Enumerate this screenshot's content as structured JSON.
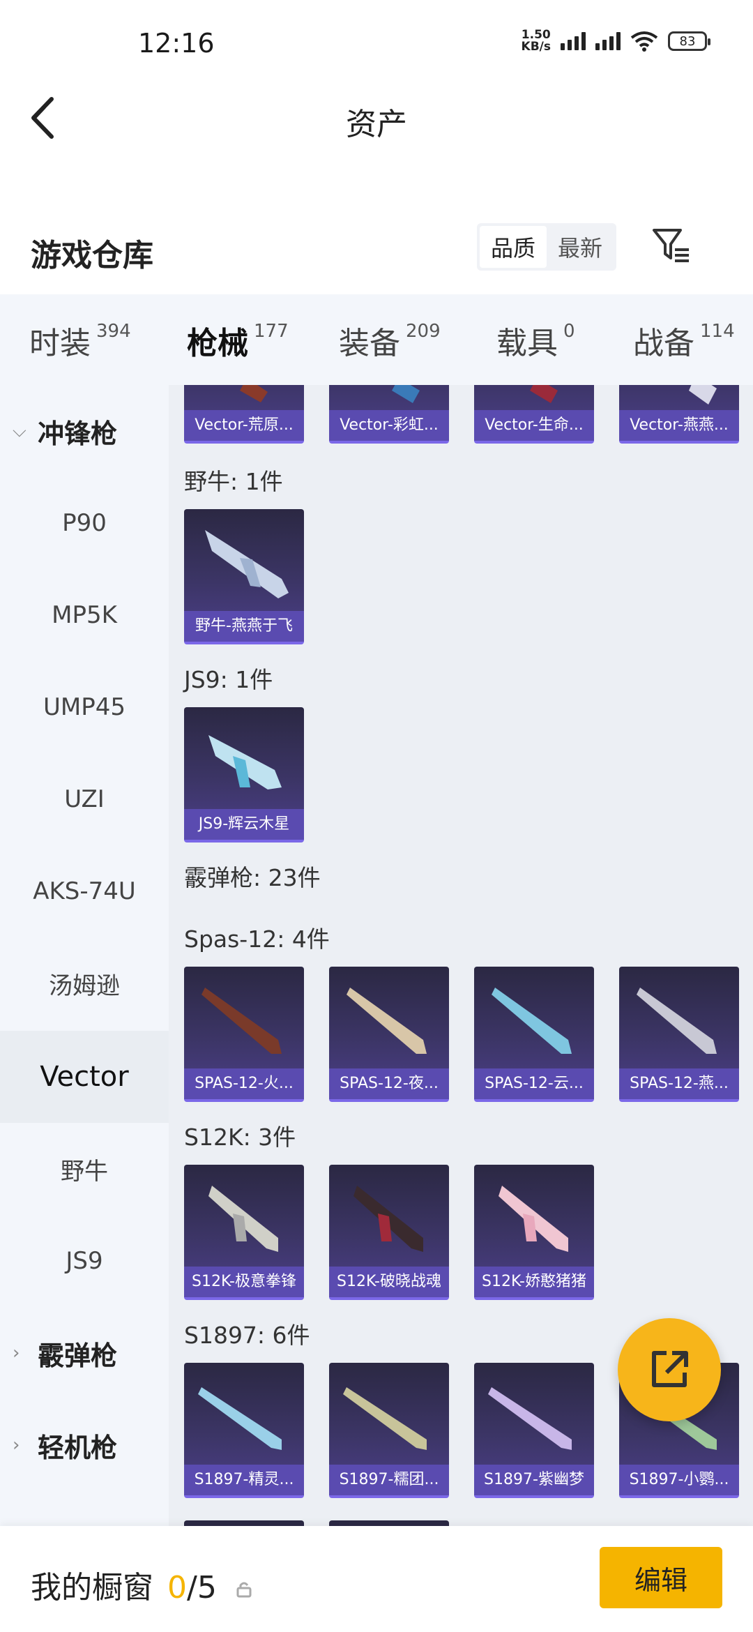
{
  "status_bar": {
    "time": "12:16",
    "net_speed_value": "1.50",
    "net_speed_unit": "KB/s",
    "battery": "83"
  },
  "header": {
    "title": "资产"
  },
  "warehouse": {
    "title": "游戏仓库",
    "sort_options": [
      "品质",
      "最新"
    ],
    "sort_active": "品质"
  },
  "tabs": [
    {
      "name": "时装",
      "count": "394"
    },
    {
      "name": "枪械",
      "count": "177"
    },
    {
      "name": "装备",
      "count": "209"
    },
    {
      "name": "载具",
      "count": "0"
    },
    {
      "name": "战备",
      "count": "114"
    }
  ],
  "sidebar": {
    "group_smg": "冲锋枪",
    "items": [
      "P90",
      "MP5K",
      "UMP45",
      "UZI",
      "AKS-74U",
      "汤姆逊",
      "Vector",
      "野牛",
      "JS9"
    ],
    "group_shotgun": "霰弹枪",
    "group_lmg": "轻机枪"
  },
  "content": {
    "vector_cards": [
      "Vector-荒原...",
      "Vector-彩虹...",
      "Vector-生命...",
      "Vector-燕燕..."
    ],
    "bison_label": "野牛: 1件",
    "bison_cards": [
      "野牛-燕燕于飞"
    ],
    "js9_label": "JS9: 1件",
    "js9_cards": [
      "JS9-辉云木星"
    ],
    "shotgun_label": "霰弹枪: 23件",
    "spas_label": "Spas-12: 4件",
    "spas_cards": [
      "SPAS-12-火...",
      "SPAS-12-夜...",
      "SPAS-12-云...",
      "SPAS-12-燕..."
    ],
    "s12k_label": "S12K: 3件",
    "s12k_cards": [
      "S12K-极意拳锋",
      "S12K-破晓战魂",
      "S12K-娇憨猪猪"
    ],
    "s1897_label": "S1897: 6件",
    "s1897_cards": [
      "S1897-精灵...",
      "S1897-糯团...",
      "S1897-紫幽梦",
      "S1897-小鹦..."
    ]
  },
  "bottom_bar": {
    "showcase_label": "我的橱窗",
    "current": "0",
    "separator": "/",
    "max": "5",
    "edit_label": "编辑"
  },
  "colors": {
    "accent": "#f5b400",
    "card_caption": "#5a4bb0",
    "sidebar_bg": "#f3f6fb",
    "content_bg": "#eceff4"
  }
}
